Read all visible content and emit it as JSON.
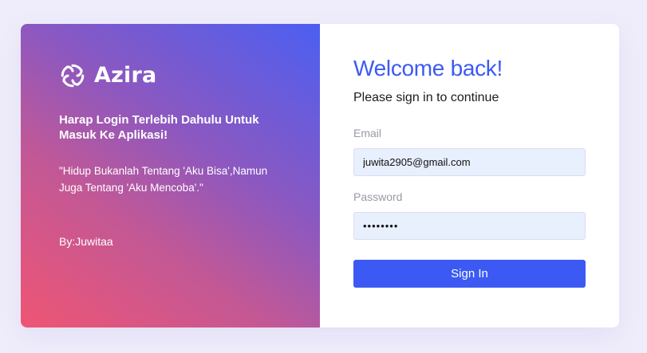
{
  "brand": {
    "name": "Azira",
    "logo_icon": "swirl-logo-icon"
  },
  "intro": {
    "headline": "Harap Login Terlebih Dahulu Untuk Masuk Ke Aplikasi!",
    "quote": "\"Hidup Bukanlah Tentang 'Aku Bisa',Namun Juga Tentang 'Aku Mencoba'.\"",
    "author": "By:Juwitaa"
  },
  "login": {
    "title": "Welcome back!",
    "subtitle": "Please sign in to continue",
    "email_label": "Email",
    "email_value": "juwita2905@gmail.com",
    "password_label": "Password",
    "password_value": "12345678",
    "submit_label": "Sign In"
  },
  "colors": {
    "accent": "#3c5af3",
    "background": "#efedfb",
    "input_fill": "#e8effd",
    "gradient_start": "#ef5573",
    "gradient_end": "#4b5ff2"
  }
}
